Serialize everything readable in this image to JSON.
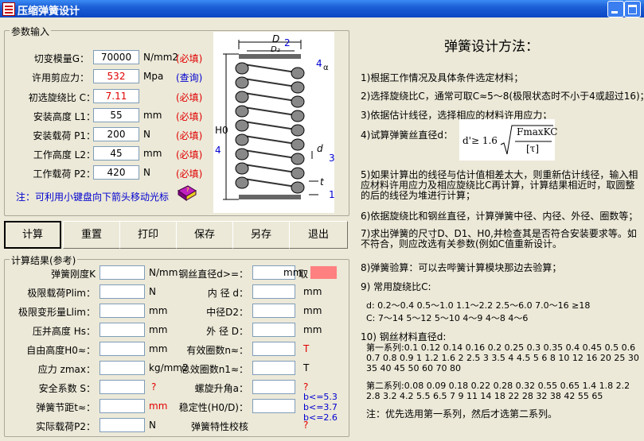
{
  "window": {
    "title": "压缩弹簧设计"
  },
  "params": {
    "legend": "参数输入",
    "rows": [
      {
        "label": "切变模量G：",
        "value": "70000",
        "unit": "N/mm2",
        "tag": "(必填)"
      },
      {
        "label": "许用剪应力：",
        "value": "532",
        "unit": "Mpa",
        "tag": "(查询)"
      },
      {
        "label": "初选旋绕比 C：",
        "value": "7.11",
        "unit": "",
        "tag": "(必填)"
      },
      {
        "label": "安装高度 L1：",
        "value": "55",
        "unit": "mm",
        "tag": "(必填)"
      },
      {
        "label": "安装载荷 P1：",
        "value": "200",
        "unit": "N",
        "tag": "(必填)"
      },
      {
        "label": "工作高度 L2：",
        "value": "45",
        "unit": "mm",
        "tag": "(必填)"
      },
      {
        "label": "工作载荷 P2：",
        "value": "420",
        "unit": "N",
        "tag": "(必填)"
      }
    ],
    "note": "注：可利用小键盘向下箭头移动光标"
  },
  "diagram": {
    "d_label": "D",
    "d2_label": "D₂",
    "h0_label": "H0",
    "small_d": "d",
    "t_label": "t",
    "a_label": "α",
    "n1": "1",
    "n2": "2",
    "n3": "3",
    "n4": "4",
    "n4b": "4"
  },
  "buttons": {
    "calc": "计算",
    "reset": "重置",
    "print": "打印",
    "save": "保存",
    "saveas": "另存",
    "exit": "退出"
  },
  "results": {
    "legend": "计算结果(参考)",
    "left": [
      {
        "label": "弹簧刚度K",
        "unit": "N/mm",
        "extra": ""
      },
      {
        "label": "极限载荷Plim：",
        "unit": "N",
        "extra": ""
      },
      {
        "label": "极限变形量Llim：",
        "unit": "mm",
        "extra": ""
      },
      {
        "label": "压并高度 Hs：",
        "unit": "mm",
        "extra": ""
      },
      {
        "label": "自由高度H0≈：",
        "unit": "mm",
        "extra": ""
      },
      {
        "label": "应力 zmax：",
        "unit": "kg/mm2",
        "extra": ""
      },
      {
        "label": "安全系数 S：",
        "unit": "",
        "extra": "?"
      },
      {
        "label": "弹簧节距t≈：",
        "unit": "mm",
        "extra": ""
      },
      {
        "label": "实际载荷P2：",
        "unit": "N",
        "extra": ""
      }
    ],
    "right": [
      {
        "label": "钢丝直径d>=：",
        "unit": "mm",
        "extra": "取"
      },
      {
        "label": "内 径 d：",
        "unit": "mm",
        "extra": ""
      },
      {
        "label": "中径D2：",
        "unit": "mm",
        "extra": ""
      },
      {
        "label": "外 径 D：",
        "unit": "mm",
        "extra": ""
      },
      {
        "label": "有效圈数n≈：",
        "unit": "T",
        "extra": ""
      },
      {
        "label": "总效圈数n1≈：",
        "unit": "T",
        "extra": ""
      },
      {
        "label": "螺旋升角a：",
        "unit": "?",
        "extra": ""
      },
      {
        "label": "稳定性(H0/D)：",
        "unit": "",
        "extra": ""
      },
      {
        "label": "弹簧特性校核",
        "unit": "?",
        "extra": ""
      }
    ],
    "b1": "b<=5.3",
    "b2": "b<=3.7",
    "b3": "b<=2.6"
  },
  "method": {
    "title": "弹簧设计方法：",
    "s1": "1)根据工作情况及具体条件选定材料；",
    "s2": "2)选择旋绕比C，通常可取C≈5～8(极限状态时不小于4或超过16)；",
    "s3": "3)依据估计线径，选择相应的材料许用应力；",
    "s4": "4)试算弹簧丝直径d：",
    "formula": "d'≥ 1.6",
    "formula_num": "FmaxKC",
    "formula_den": "[τ]",
    "s5": "5)如果计算出的线径与估计值相差太大，则重新估计线径，输入相应材料许用应力及相应旋绕比C再计算，计算结果相近时，取圆整的后的线径为堆进行计算；",
    "s6": "6)依据旋绕比和钢丝直径，计算弹簧中径、内径、外径、圈数等；",
    "s7": "7)求出弹簧的尺寸D、D1、H0,并检查其是否符合安装要求等。如不符合，则应改选有关参数(例如C值重新设计。",
    "s8": "8)弹簧验算：可以去哔簧计算模块那边去验算；",
    "s9": "9) 常用旋绕比C:",
    "d_row": "d: 0.2～0.4  0.5～1.0  1.1～2.2  2.5～6.0  7.0～16  ≥18",
    "c_row": "C:  7～14    5～12    5～10    4～9     4～8    4～6",
    "s10": "10) 钢丝材料直径d:",
    "series1": "第一系列:0.1 0.12 0.14 0.16 0.2 0.25 0.3 0.35 0.4 0.45 0.5 0.6 0.7 0.8 0.9 1 1.2 1.6 2 2.5 3 3.5 4 4.5 5 6 8 10 12 16 20 25 30 35 40 45 50 60 70 80",
    "series2": "第二系列:0.08 0.09 0.18 0.22 0.28 0.32 0.55 0.65 1.4 1.8 2.2 2.8 3.2 4.2 5.5 6.5 7 9 11 14 18  22 28 32 38 42 55 65",
    "note": "注：优先选用第一系列，然后才选第二系列。"
  },
  "colors": {
    "accent_red": "#e00000",
    "query_blue": "#0000d0",
    "swatch": "#ff8080"
  }
}
